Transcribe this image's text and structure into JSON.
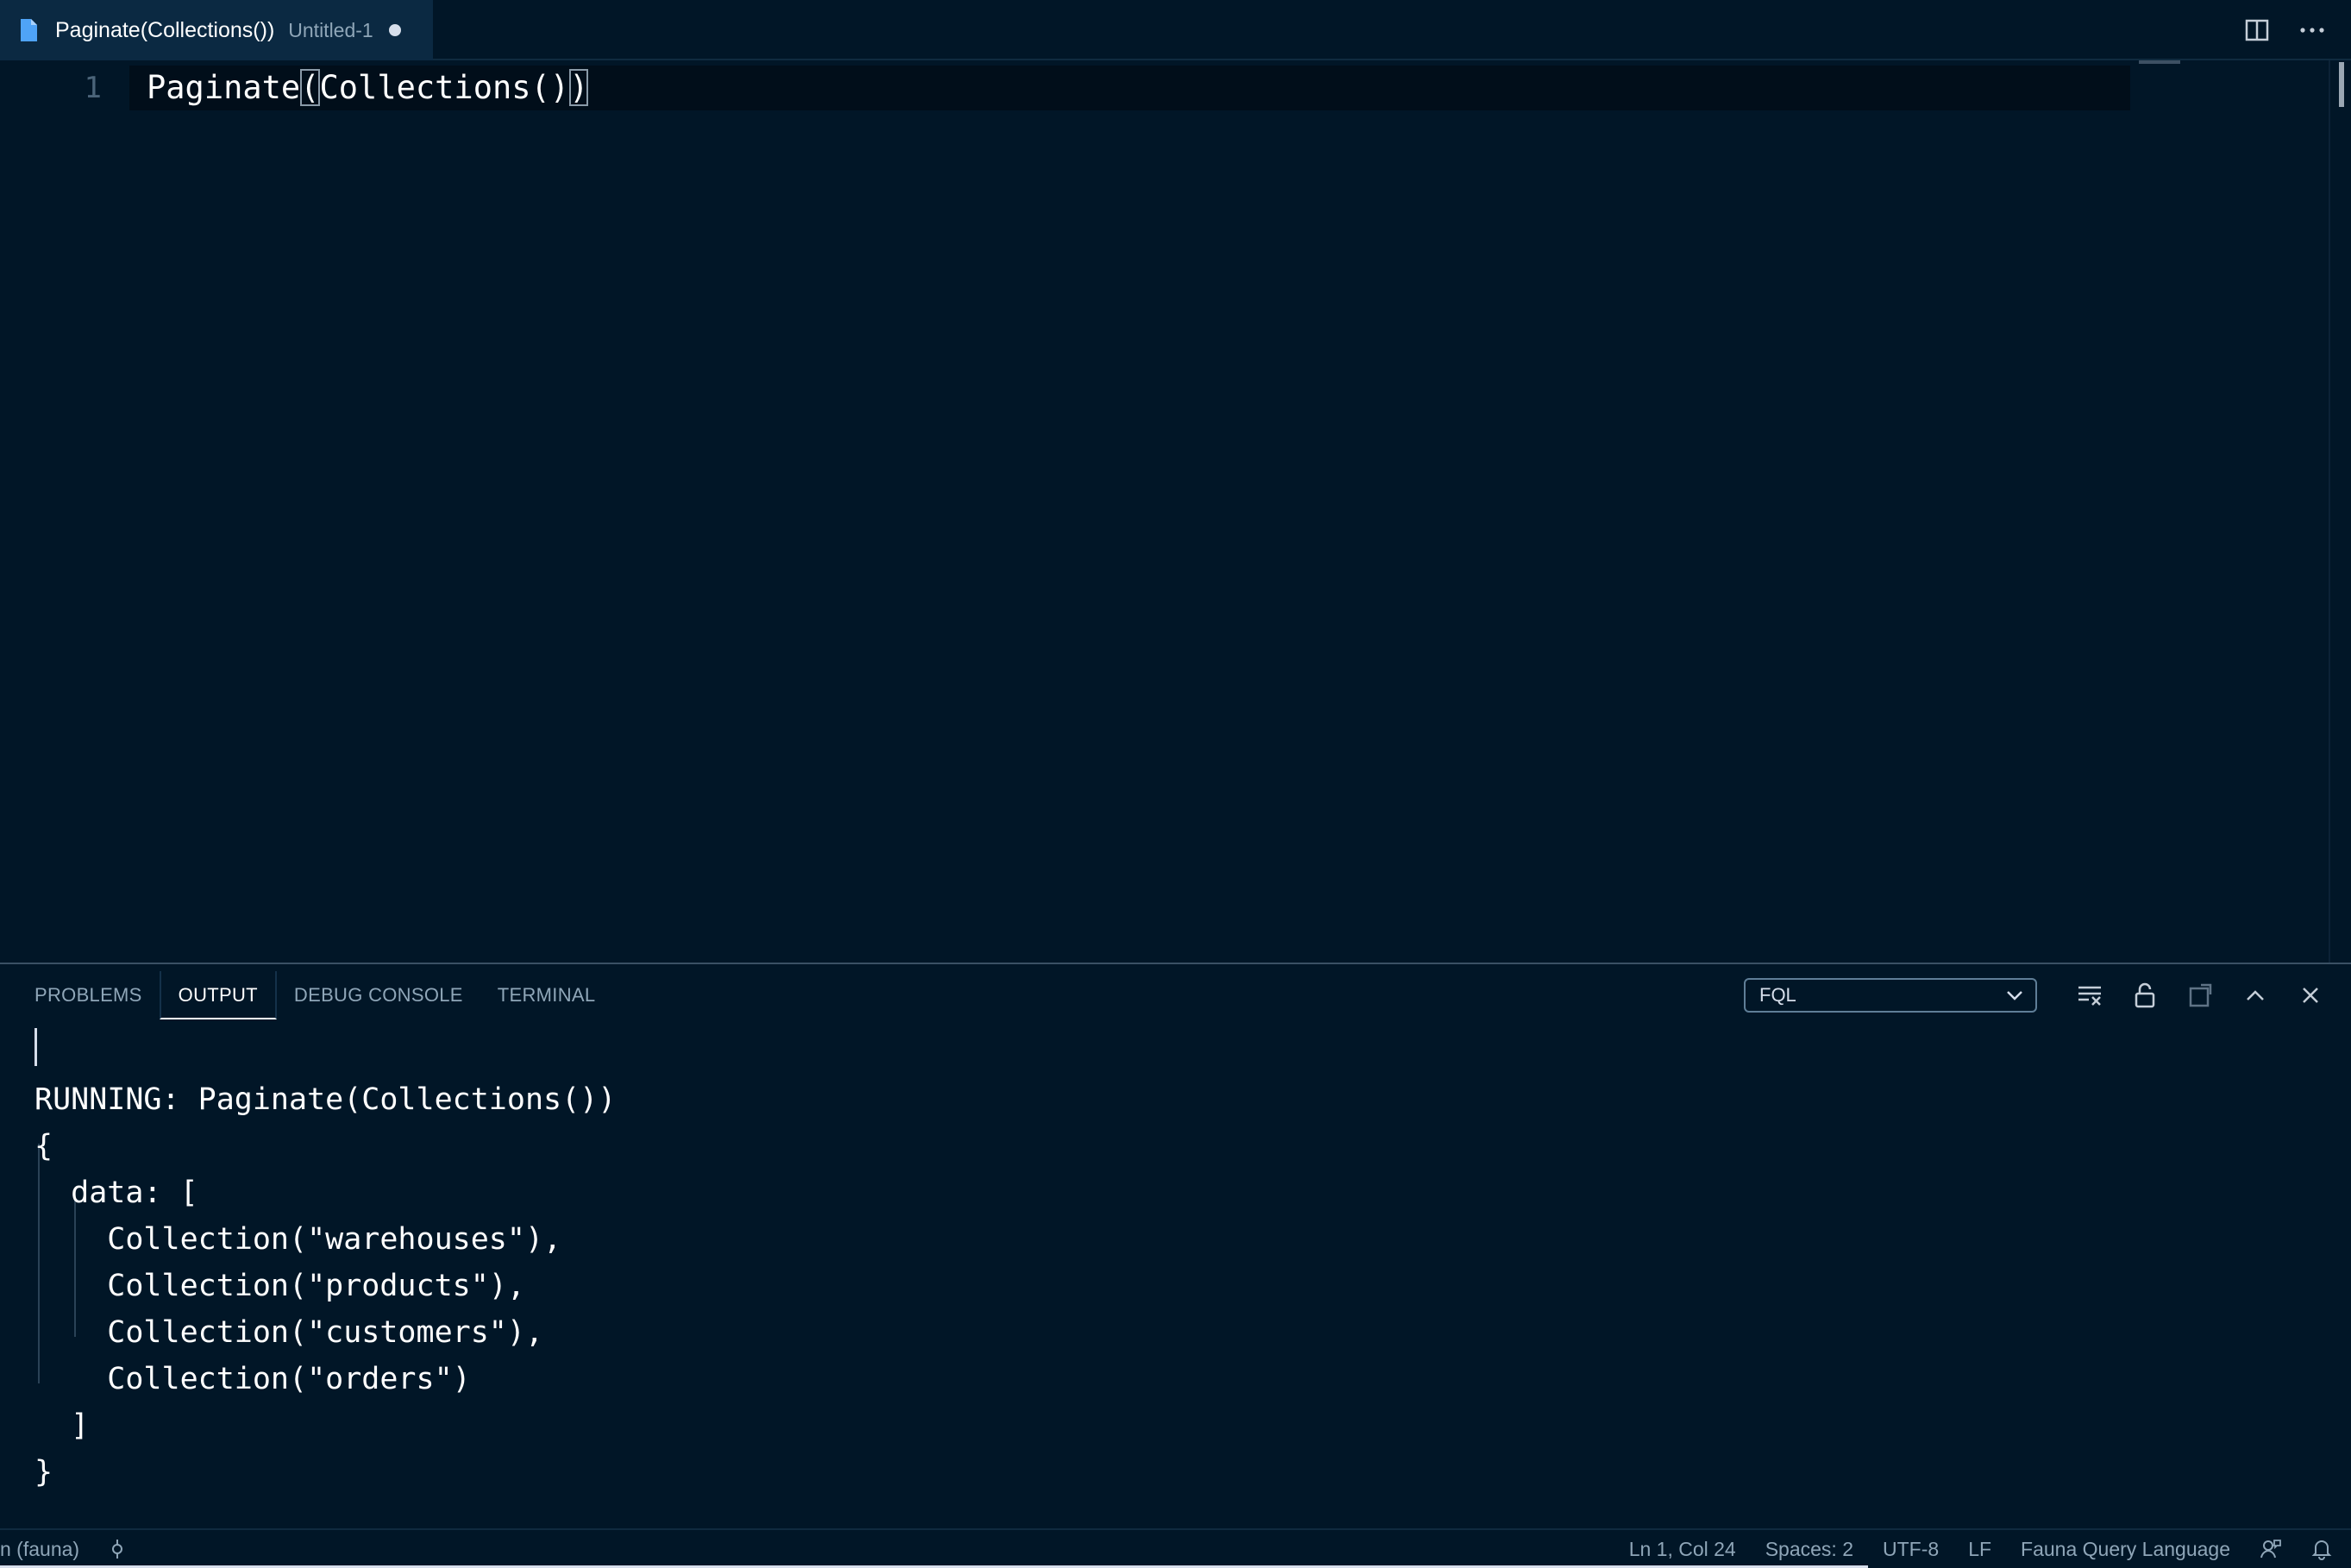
{
  "tab": {
    "title": "Paginate(Collections())",
    "description": "Untitled-1"
  },
  "editor": {
    "line_number": "1",
    "code": {
      "part1": "Paginate",
      "open_paren": "(",
      "part2": "Collections()",
      "close_paren": ")"
    }
  },
  "panel": {
    "tabs": [
      "PROBLEMS",
      "OUTPUT",
      "DEBUG CONSOLE",
      "TERMINAL"
    ],
    "active_tab": "OUTPUT",
    "output_channel": "FQL",
    "output_lines": [
      "RUNNING: Paginate(Collections())",
      "{",
      "  data: [",
      "    Collection(\"warehouses\"),",
      "    Collection(\"products\"),",
      "    Collection(\"customers\"),",
      "    Collection(\"orders\")",
      "  ]",
      "}"
    ]
  },
  "statusbar": {
    "branch": "n (fauna)",
    "position": "Ln 1, Col 24",
    "spaces": "Spaces: 2",
    "encoding": "UTF-8",
    "eol": "LF",
    "language": "Fauna Query Language"
  },
  "icons": {
    "tab_file": "file-icon",
    "split": "split-editor-icon",
    "more": "more-actions-icon",
    "clear": "clear-output-icon",
    "lock": "lock-scroll-icon",
    "open_editor": "open-in-editor-icon",
    "maximize": "chevron-up-icon",
    "close": "close-icon",
    "chevron": "chevron-down-icon",
    "sync": "git-sync-icon",
    "feedback": "feedback-icon",
    "bell": "bell-icon"
  },
  "colors": {
    "background": "#011627",
    "tab_active": "#0b2942",
    "accent_file": "#4fa3f7"
  }
}
